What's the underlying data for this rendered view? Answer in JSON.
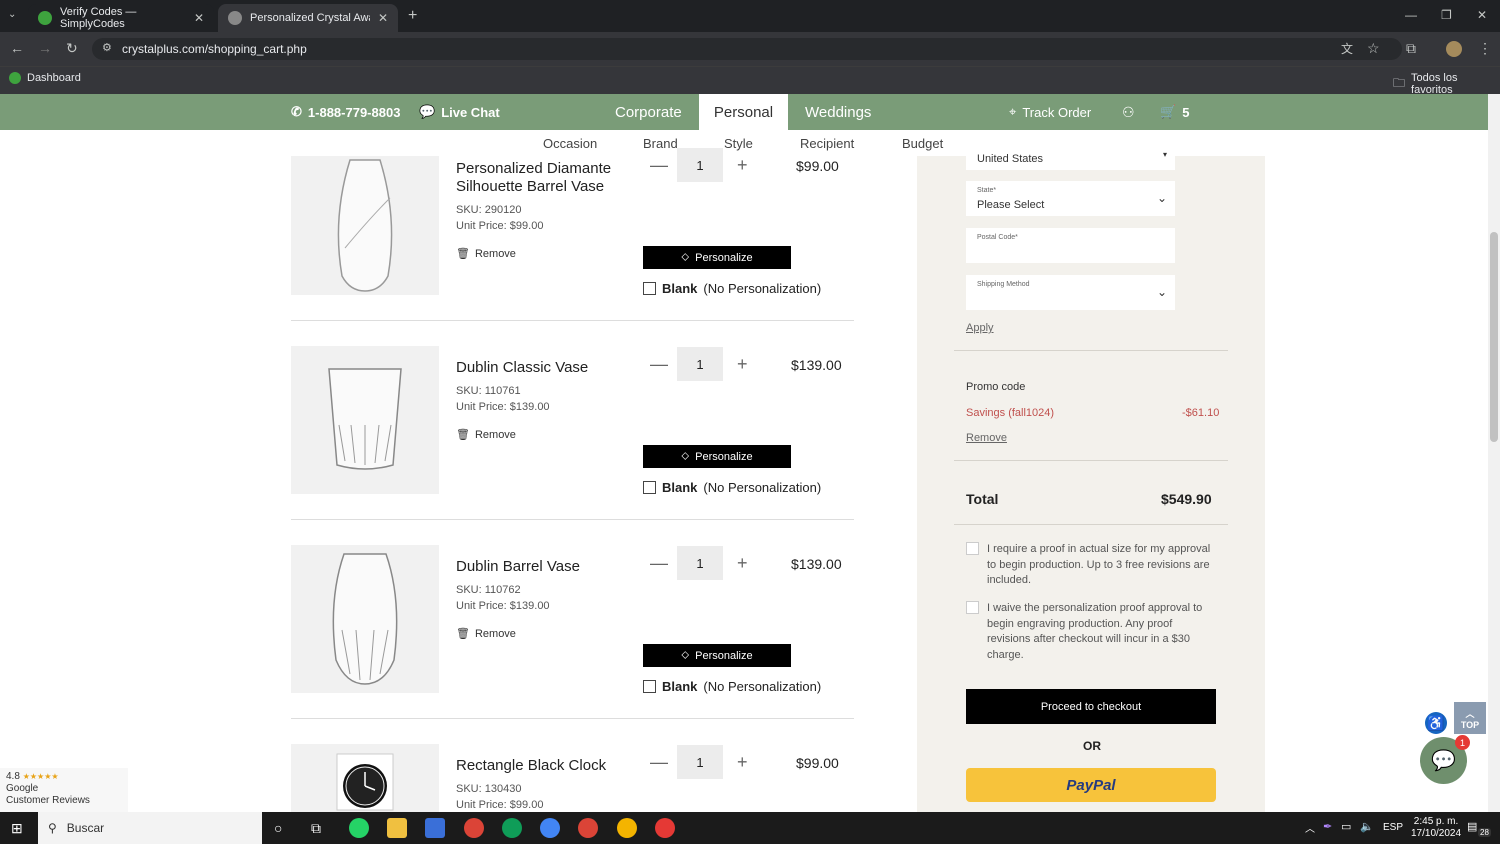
{
  "browser": {
    "tabs": [
      {
        "title": "Verify Codes — SimplyCodes"
      },
      {
        "title": "Personalized Crystal Awards, Gi"
      }
    ],
    "url": "crystalplus.com/shopping_cart.php",
    "bookmarks": {
      "dashboard": "Dashboard",
      "favorites": "Todos los favoritos"
    }
  },
  "site_nav": {
    "phone": "1-888-779-8803",
    "live_chat": "Live Chat",
    "menu": [
      "Corporate",
      "Personal",
      "Weddings"
    ],
    "track_order": "Track Order",
    "cart_count": "5",
    "sub_menu": [
      "Occasion",
      "Brand",
      "Style",
      "Recipient",
      "Budget"
    ]
  },
  "cart": {
    "items": [
      {
        "name": "Personalized Diamante Silhouette Barrel Vase",
        "sku": "SKU: 290120",
        "unit_price": "Unit Price: $99.00",
        "qty": "1",
        "price": "$99.00"
      },
      {
        "name": "Dublin Classic Vase",
        "sku": "SKU: 110761",
        "unit_price": "Unit Price: $139.00",
        "qty": "1",
        "price": "$139.00"
      },
      {
        "name": "Dublin Barrel Vase",
        "sku": "SKU: 110762",
        "unit_price": "Unit Price: $139.00",
        "qty": "1",
        "price": "$139.00"
      },
      {
        "name": "Rectangle Black Clock",
        "sku": "SKU: 130430",
        "unit_price": "Unit Price: $99.00",
        "qty": "1",
        "price": "$99.00"
      }
    ],
    "remove_label": "Remove",
    "personalize_label": "Personalize",
    "blank_bold": "Blank",
    "blank_rest": "(No Personalization)",
    "minus": "—",
    "plus": "+"
  },
  "summary": {
    "country": "United States",
    "state_label": "State*",
    "state_value": "Please Select",
    "postal_label": "Postal Code*",
    "shipping_label": "Shipping Method",
    "apply": "Apply",
    "promo_label": "Promo code",
    "savings_label": "Savings (fall1024)",
    "savings_value": "-$61.10",
    "promo_remove": "Remove",
    "total_label": "Total",
    "total_value": "$549.90",
    "consent_1": "I require a proof in actual size for my approval to begin production. Up to 3 free revisions are included.",
    "consent_2": "I waive the personalization proof approval to begin engraving production. Any proof revisions after checkout will incur in a $30 charge.",
    "checkout": "Proceed to checkout",
    "or": "OR",
    "paypal": "PayPal"
  },
  "widgets": {
    "google_rating": "4.8",
    "google_stars": "★★★★★",
    "google_name": "Google",
    "google_sub": "Customer Reviews",
    "top": "TOP",
    "chat_badge": "1"
  },
  "taskbar": {
    "search": "Buscar",
    "lang": "ESP",
    "time": "2:45 p. m.",
    "date": "17/10/2024",
    "notif": "28"
  },
  "colors": {
    "nav_green": "#7a9c78",
    "savings_red": "#c0504d",
    "paypal_yellow": "#f7c33b"
  }
}
